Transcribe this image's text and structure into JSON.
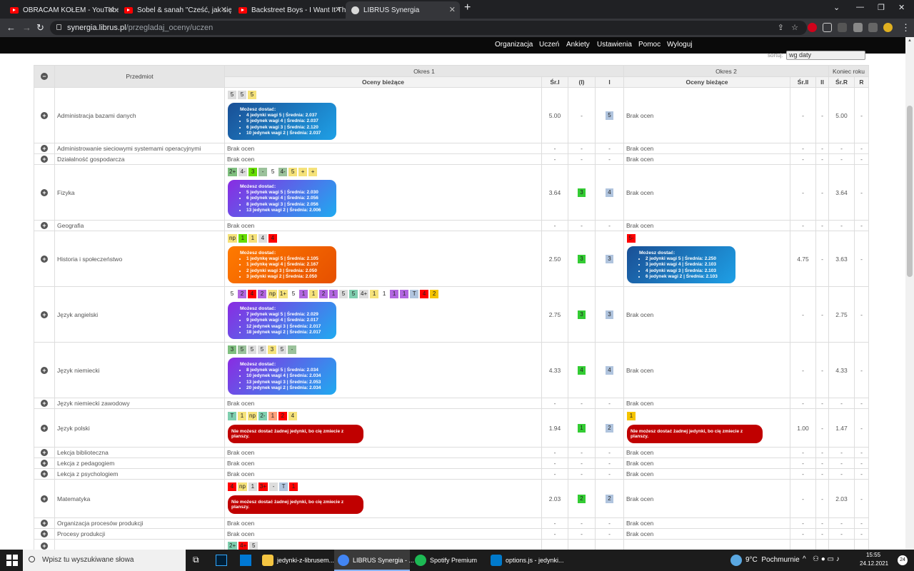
{
  "browser": {
    "tabs": [
      {
        "title": "OBRACAM KOŁEM - YouTube"
      },
      {
        "title": "Sobel & sanah \"Cześć, jak się ma"
      },
      {
        "title": "Backstreet Boys - I Want It Th"
      },
      {
        "title": "LIBRUS Synergia"
      }
    ],
    "url_domain": "synergia.librus.pl",
    "url_path": "/przegladaj_oceny/uczen"
  },
  "nav": {
    "items": [
      "Organizacja",
      "Uczeń",
      "Ankiety",
      "Ustawienia",
      "Pomoc",
      "Wyloguj"
    ]
  },
  "sort": {
    "label": "sortuj:",
    "value": "wg daty"
  },
  "table": {
    "head": {
      "przedmiot": "Przedmiot",
      "okres1": "Okres 1",
      "okres2": "Okres 2",
      "koniec": "Koniec roku",
      "oceny_biezace": "Oceny bieżące",
      "sr1": "Śr.I",
      "p1": "(I)",
      "i": "I",
      "sr2": "Śr.II",
      "ii": "II",
      "srR": "Śr.R",
      "r": "R"
    },
    "brak": "Brak ocen",
    "rows": [
      {
        "name": "Administracja bazami danych",
        "g1": [
          [
            "5",
            "#ddd"
          ],
          [
            "5",
            "#ddd"
          ],
          [
            "5",
            "#f5e27a"
          ]
        ],
        "info1": {
          "title": "Możesz dostać:",
          "grad": "blue",
          "items": [
            "4 jedynki wagi 5 | Średnia: 2.037",
            "5 jedynek wagi 4 | Średnia: 2.037",
            "6 jedynek wagi 3 | Średnia: 2.120",
            "10 jedynek wagi 2 | Średnia: 2.037"
          ]
        },
        "sr1": "5.00",
        "p1": "-",
        "i": "5",
        "sr2": "-",
        "ii": "-",
        "srR": "5.00",
        "r": "-"
      },
      {
        "name": "Administrowanie sieciowymi systemami operacyjnymi",
        "sr1": "-",
        "p1": "-",
        "i": "-",
        "sr2": "-",
        "ii": "-",
        "srR": "-",
        "r": "-"
      },
      {
        "name": "Działalność gospodarcza",
        "sr1": "-",
        "p1": "-",
        "i": "-",
        "sr2": "-",
        "ii": "-",
        "srR": "-",
        "r": "-"
      },
      {
        "name": "Fizyka",
        "g1": [
          [
            "2+",
            "#7fbf7f"
          ],
          [
            "4-",
            "#ddd"
          ],
          [
            "3",
            "#66dd00"
          ],
          [
            "-",
            "#9bc29b"
          ],
          [
            "5",
            "#fff"
          ],
          [
            "4-",
            "#9bc29b"
          ],
          [
            "5",
            "#f5e27a"
          ],
          [
            "+",
            "#f5e27a"
          ],
          [
            "+",
            "#f5e27a"
          ]
        ],
        "info1": {
          "title": "Możesz dostać:",
          "grad": "purple",
          "items": [
            "5 jedynek wagi 5 | Średnia: 2.030",
            "6 jedynek wagi 4 | Średnia: 2.056",
            "8 jedynek wagi 3 | Średnia: 2.056",
            "13 jedynek wagi 2 | Średnia: 2.006"
          ]
        },
        "sr1": "3.64",
        "p1": "3",
        "i": "4",
        "sr2": "-",
        "ii": "-",
        "srR": "3.64",
        "r": "-"
      },
      {
        "name": "Geografia",
        "sr1": "-",
        "p1": "-",
        "i": "-",
        "sr2": "-",
        "ii": "-",
        "srR": "-",
        "r": "-"
      },
      {
        "name": "Historia i społeczeństwo",
        "g1": [
          [
            "np",
            "#f5e27a"
          ],
          [
            "1",
            "#66dd00"
          ],
          [
            "1",
            "#f5e27a"
          ],
          [
            "4",
            "#ddd"
          ],
          [
            "4",
            "#ff0000"
          ]
        ],
        "info1": {
          "title": "Możesz dostać:",
          "grad": "orange",
          "items": [
            "1 jedynkę wagi 5 | Średnia: 2.105",
            "1 jedynkę wagi 4 | Średnia: 2.167",
            "2 jedynki wagi 3 | Średnia: 2.050",
            "3 jedynki wagi 2 | Średnia: 2.050"
          ]
        },
        "g2": [
          [
            "5-",
            "#ff0000"
          ]
        ],
        "info2": {
          "title": "Możesz dostać:",
          "grad": "blue",
          "items": [
            "2 jedynki wagi 5 | Średnia: 2.250",
            "3 jedynki wagi 4 | Średnia: 2.103",
            "4 jedynki wagi 3 | Średnia: 2.103",
            "6 jedynek wagi 2 | Średnia: 2.103"
          ]
        },
        "sr1": "2.50",
        "p1": "3",
        "i": "3",
        "sr2": "4.75",
        "ii": "-",
        "srR": "3.63",
        "r": "-"
      },
      {
        "name": "Język angielski",
        "g1": [
          [
            "5",
            "#fff"
          ],
          [
            "2",
            "#b266e0"
          ],
          [
            "4",
            "#ff0000"
          ],
          [
            "2",
            "#b266e0"
          ],
          [
            "np",
            "#f5e27a"
          ],
          [
            "1+",
            "#f5e27a"
          ],
          [
            "5",
            "#fff"
          ],
          [
            "1",
            "#b266e0"
          ],
          [
            "1",
            "#f5e27a"
          ],
          [
            "2",
            "#b266e0"
          ],
          [
            "1",
            "#b266e0"
          ],
          [
            "5",
            "#ddd"
          ],
          [
            "5",
            "#7fcfaf"
          ],
          [
            "4+",
            "#ddd"
          ],
          [
            "1",
            "#f5e27a"
          ],
          [
            "1",
            "#fff"
          ],
          [
            "1",
            "#b266e0"
          ],
          [
            "1",
            "#b266e0"
          ],
          [
            "T",
            "#b0c4de"
          ],
          [
            "4",
            "#ff0000"
          ],
          [
            "2",
            "#f5c400"
          ]
        ],
        "info1": {
          "title": "Możesz dostać:",
          "grad": "purple",
          "items": [
            "7 jedynek wagi 5 | Średnia: 2.029",
            "9 jedynek wagi 4 | Średnia: 2.017",
            "12 jedynek wagi 3 | Średnia: 2.017",
            "18 jedynek wagi 2 | Średnia: 2.017"
          ]
        },
        "sr1": "2.75",
        "p1": "3",
        "i": "3",
        "sr2": "-",
        "ii": "-",
        "srR": "2.75",
        "r": "-"
      },
      {
        "name": "Język niemiecki",
        "g1": [
          [
            "3",
            "#7fbf7f"
          ],
          [
            "5",
            "#9bc29b"
          ],
          [
            "5",
            "#ddd"
          ],
          [
            "5",
            "#ddd"
          ],
          [
            "3",
            "#f5e27a"
          ],
          [
            "5",
            "#ddd"
          ],
          [
            "-",
            "#9bc29b"
          ]
        ],
        "info1": {
          "title": "Możesz dostać:",
          "grad": "purple",
          "items": [
            "8 jedynek wagi 5 | Średnia: 2.034",
            "10 jedynek wagi 4 | Średnia: 2.034",
            "13 jedynek wagi 3 | Średnia: 2.053",
            "20 jedynek wagi 2 | Średnia: 2.034"
          ]
        },
        "sr1": "4.33",
        "p1": "4",
        "i": "4",
        "sr2": "-",
        "ii": "-",
        "srR": "4.33",
        "r": "-"
      },
      {
        "name": "Język niemiecki zawodowy",
        "sr1": "-",
        "p1": "-",
        "i": "-",
        "sr2": "-",
        "ii": "-",
        "srR": "-",
        "r": "-"
      },
      {
        "name": "Język polski",
        "g1": [
          [
            "T",
            "#7fcfaf"
          ],
          [
            "1",
            "#f5e27a"
          ],
          [
            "np",
            "#f5e27a"
          ],
          [
            "2-",
            "#7fcfaf"
          ],
          [
            "1",
            "#ffa07a"
          ],
          [
            "2",
            "#ff0000"
          ],
          [
            "4",
            "#f5e27a"
          ]
        ],
        "bad1": "Nie możesz dostać żadnej jedynki, bo cię zmiecie z planszy.",
        "g2": [
          [
            "1",
            "#f5c400"
          ]
        ],
        "bad2": "Nie możesz dostać żadnej jedynki, bo cię zmiecie z planszy.",
        "sr1": "1.94",
        "p1": "1",
        "i": "2",
        "sr2": "1.00",
        "ii": "-",
        "srR": "1.47",
        "r": "-"
      },
      {
        "name": "Lekcja biblioteczna",
        "sr1": "-",
        "p1": "-",
        "i": "-",
        "sr2": "-",
        "ii": "-",
        "srR": "-",
        "r": "-"
      },
      {
        "name": "Lekcja z pedagogiem",
        "sr1": "-",
        "p1": "-",
        "i": "-",
        "sr2": "-",
        "ii": "-",
        "srR": "-",
        "r": "-"
      },
      {
        "name": "Lekcja z psychologiem",
        "sr1": "-",
        "p1": "-",
        "i": "-",
        "sr2": "-",
        "ii": "-",
        "srR": "-",
        "r": "-"
      },
      {
        "name": "Matematyka",
        "g1": [
          [
            "4",
            "#ff0000"
          ],
          [
            "np",
            "#f5e27a"
          ],
          [
            "1",
            "#ddd"
          ],
          [
            "3+",
            "#ff0000"
          ],
          [
            "-",
            "#ddd"
          ],
          [
            "T",
            "#b0c4de"
          ],
          [
            "1",
            "#ff0000"
          ]
        ],
        "bad1": "Nie możesz dostać żadnej jedynki, bo cię zmiecie z planszy.",
        "sr1": "2.03",
        "p1": "2",
        "i": "2",
        "sr2": "-",
        "ii": "-",
        "srR": "2.03",
        "r": "-"
      },
      {
        "name": "Organizacja procesów produkcji",
        "sr1": "-",
        "p1": "-",
        "i": "-",
        "sr2": "-",
        "ii": "-",
        "srR": "-",
        "r": "-"
      },
      {
        "name": "Procesy produkcji",
        "sr1": "-",
        "p1": "-",
        "i": "-",
        "sr2": "-",
        "ii": "-",
        "srR": "-",
        "r": "-"
      },
      {
        "name": "",
        "g1": [
          [
            "2+",
            "#7fcfaf"
          ],
          [
            "4+",
            "#ff0000"
          ],
          [
            "5",
            "#ddd"
          ]
        ],
        "sr1": "",
        "p1": "",
        "i": "",
        "sr2": "",
        "ii": "",
        "srR": "",
        "r": ""
      }
    ]
  },
  "taskbar": {
    "search_placeholder": "Wpisz tu wyszukiwane słowa",
    "apps": [
      "jedynki-z-librusem...",
      "LIBRUS Synergia - ...",
      "Spotify Premium",
      "options.js - jedynki..."
    ],
    "weather": "9°C  Pochmurnie",
    "time": "15:55",
    "date": "24.12.2021",
    "notif": "24"
  },
  "colors": {
    "p1_bg": "#33cc33",
    "i_bg": "#b0c4de",
    "blue_grad": "#1a5fa8",
    "purple_grad": "#a020f0",
    "orange_grad": "#ff6a00"
  }
}
